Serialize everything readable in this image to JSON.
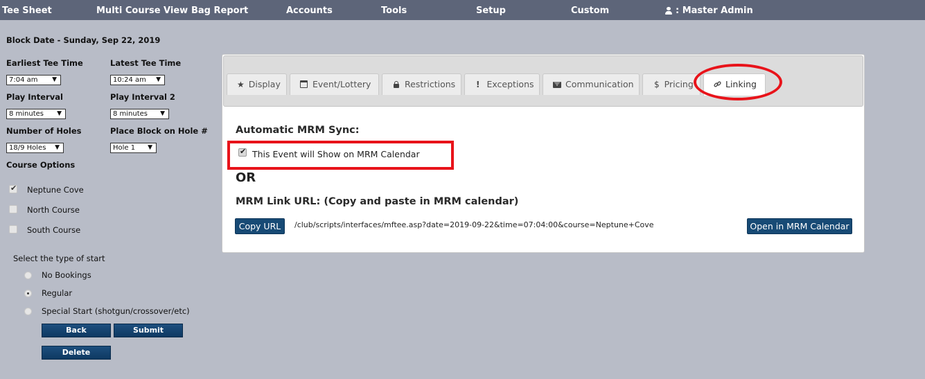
{
  "nav": {
    "items": [
      "Tee Sheet",
      "Multi Course View",
      "Bag Report",
      "Accounts",
      "Tools",
      "Setup",
      "Custom"
    ],
    "user": ": Master Admin"
  },
  "left": {
    "block_date": "Block Date - Sunday, Sep 22, 2019",
    "earliest_label": "Earliest Tee Time",
    "earliest_value": "7:04 am",
    "latest_label": "Latest Tee Time",
    "latest_value": "10:24 am",
    "interval_label": "Play Interval",
    "interval_value": "8 minutes",
    "interval2_label": "Play Interval 2",
    "interval2_value": "8 minutes",
    "holes_label": "Number of Holes",
    "holes_value": "18/9 Holes",
    "place_label": "Place Block on Hole #",
    "place_value": "Hole 1",
    "course_options_label": "Course Options",
    "courses": [
      {
        "name": "Neptune Cove",
        "checked": true
      },
      {
        "name": "North Course",
        "checked": false
      },
      {
        "name": "South Course",
        "checked": false
      }
    ],
    "start_type_label": "Select the type of start",
    "start_types": [
      {
        "name": "No Bookings",
        "selected": false
      },
      {
        "name": "Regular",
        "selected": true
      },
      {
        "name": "Special Start (shotgun/crossover/etc)",
        "selected": false
      }
    ],
    "back_label": "Back",
    "submit_label": "Submit",
    "delete_label": "Delete"
  },
  "tabs": [
    {
      "label": "Display",
      "icon": "star-icon"
    },
    {
      "label": "Event/Lottery",
      "icon": "calendar-icon"
    },
    {
      "label": "Restrictions",
      "icon": "lock-icon"
    },
    {
      "label": "Exceptions",
      "icon": "exclamation-icon"
    },
    {
      "label": "Communication",
      "icon": "envelope-icon"
    },
    {
      "label": "Pricing",
      "icon": "dollar-icon"
    },
    {
      "label": "Linking",
      "icon": "link-icon",
      "active": true
    }
  ],
  "linking": {
    "auto_sync_title": "Automatic MRM Sync:",
    "show_on_calendar_label": "This Event will Show on MRM Calendar",
    "show_on_calendar_checked": true,
    "or_text": "OR",
    "link_url_title": "MRM Link URL: (Copy and paste in MRM calendar)",
    "copy_url_label": "Copy URL",
    "url": "/club/scripts/interfaces/mftee.asp?date=2019-09-22&time=07:04:00&course=Neptune+Cove",
    "open_calendar_label": "Open in MRM Calendar"
  },
  "colors": {
    "nav_bg": "#5d6579",
    "page_bg": "#b8bcc7",
    "button_blue": "#174a75",
    "annotation_red": "#e8131a"
  }
}
